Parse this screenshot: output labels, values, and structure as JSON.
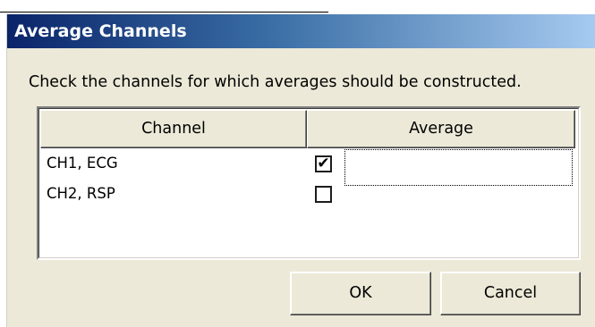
{
  "window": {
    "title": "Average Channels"
  },
  "instruction": "Check the channels for which averages should be constructed.",
  "table": {
    "columns": [
      "Channel",
      "Average"
    ],
    "rows": [
      {
        "channel": "CH1, ECG",
        "average_checked": true,
        "check_glyph": "✔"
      },
      {
        "channel": "CH2, RSP",
        "average_checked": false,
        "check_glyph": ""
      }
    ]
  },
  "buttons": {
    "ok": "OK",
    "cancel": "Cancel"
  }
}
